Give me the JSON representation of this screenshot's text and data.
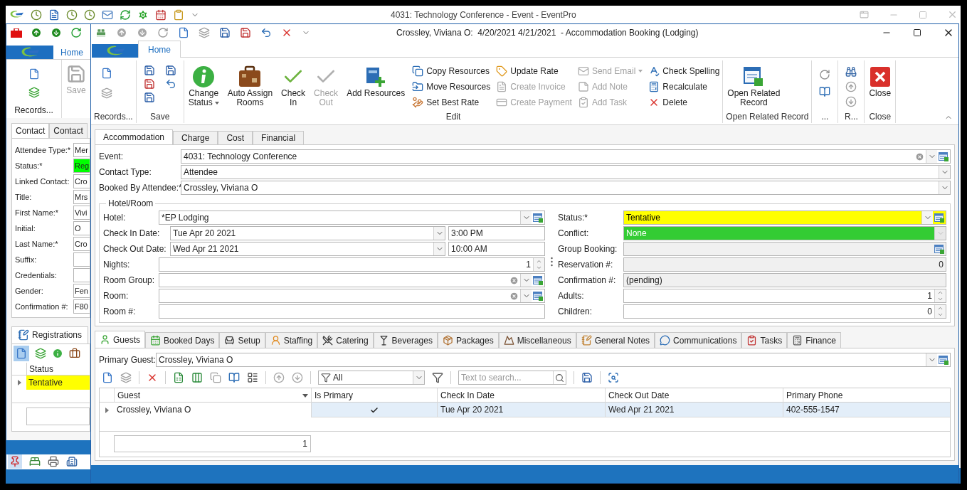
{
  "main_window": {
    "title": "4031: Technology Conference - Event - EventPro"
  },
  "contact_window": {
    "ribbon_tabs": [
      {
        "label": "Home",
        "selected": true
      }
    ],
    "ribbon_groups": [
      {
        "label": "Records..."
      }
    ],
    "save_button": {
      "label": "Save",
      "disabled": true
    },
    "tabs": [
      {
        "label": "Contact",
        "selected": true
      },
      {
        "label": "Contact",
        "selected": false
      }
    ],
    "fields": [
      {
        "label": "Attendee Type:*",
        "value": "Mer"
      },
      {
        "label": "Status:*",
        "value": "Reg",
        "color": "#00ff00"
      },
      {
        "label": "Linked Contact:",
        "value": "Cro"
      },
      {
        "label": "Title:",
        "value": "Mrs"
      },
      {
        "label": "First Name:*",
        "value": "Vivi"
      },
      {
        "label": "Initial:",
        "value": "O"
      },
      {
        "label": "Last Name:*",
        "value": "Cro"
      },
      {
        "label": "Suffix:"
      },
      {
        "label": "Credentials:"
      },
      {
        "label": "Gender:",
        "value": "Fen"
      },
      {
        "label": "Confirmation #:",
        "value": "F80"
      }
    ],
    "lower_tabs": [
      {
        "label": "Registrations",
        "selected": true
      }
    ],
    "grid": {
      "columns": [
        "Status"
      ],
      "rows": [
        {
          "cells": [
            "Tentative"
          ],
          "color": "#ffff00"
        }
      ]
    }
  },
  "booking_window": {
    "title": "Crossley, Viviana O:  4/20/2021 4/21/2021  - Accommodation Booking (Lodging)",
    "ribbon_tabs": [
      {
        "label": "Home",
        "selected": true
      }
    ],
    "ribbon_groups": [
      {
        "label": "Records..."
      },
      {
        "label": "Save"
      },
      {
        "label": "Edit",
        "large": [
          {
            "lines": [
              "Change",
              "Status"
            ],
            "dropdown": true,
            "disabled": false
          },
          {
            "lines": [
              "Auto Assign",
              "Rooms"
            ],
            "disabled": false
          },
          {
            "lines": [
              "Check",
              "In"
            ],
            "disabled": false
          },
          {
            "lines": [
              "Check",
              "Out"
            ],
            "disabled": true
          },
          {
            "lines": [
              "Add Resources"
            ],
            "disabled": false
          }
        ],
        "small_columns": [
          {
            "items": [
              {
                "label": "Copy Resources",
                "disabled": false
              },
              {
                "label": "Move Resources",
                "disabled": false
              },
              {
                "label": "Set Best Rate",
                "disabled": false
              }
            ]
          },
          {
            "items": [
              {
                "label": "Update Rate",
                "disabled": false
              },
              {
                "label": "Create Invoice",
                "disabled": true
              },
              {
                "label": "Create Payment",
                "disabled": true
              }
            ]
          },
          {
            "items": [
              {
                "label": "Send Email",
                "dropdown": true,
                "disabled": true
              },
              {
                "label": "Add Note",
                "disabled": true
              },
              {
                "label": "Add Task",
                "disabled": true
              }
            ]
          },
          {
            "items": [
              {
                "label": "Check Spelling",
                "disabled": false
              },
              {
                "label": "Recalculate",
                "disabled": false
              },
              {
                "label": "Delete",
                "disabled": false
              }
            ]
          }
        ]
      },
      {
        "label": "Open Related Record",
        "large": [
          {
            "lines": [
              "Open Related",
              "Record"
            ],
            "disabled": false
          }
        ]
      },
      {
        "label": "..."
      },
      {
        "label": "R..."
      },
      {
        "label": "Close",
        "large": [
          {
            "lines": [
              "Close"
            ],
            "disabled": false
          }
        ]
      }
    ],
    "form_tabs": [
      {
        "label": "Accommodation",
        "selected": true
      },
      {
        "label": "Charge",
        "selected": false
      },
      {
        "label": "Cost",
        "selected": false
      },
      {
        "label": "Financial",
        "selected": false
      }
    ],
    "top_fields": [
      {
        "label": "Event:",
        "value": "4031: Technology Conference",
        "kind": "clear_lookup"
      },
      {
        "label": "Contact Type:",
        "value": "Attendee",
        "kind": "combo"
      },
      {
        "label": "Booked By Attendee:*",
        "value": "Crossley, Viviana O",
        "kind": "combo"
      }
    ],
    "hotel_room": {
      "title": "Hotel/Room",
      "left_fields": [
        {
          "label": "Hotel:",
          "value": "*EP Lodging",
          "kind": "lookup"
        },
        {
          "label": "Check In Date:",
          "value": "Tue Apr 20 2021",
          "time": "3:00 PM",
          "kind": "date"
        },
        {
          "label": "Check Out Date:",
          "value": "Wed Apr 21 2021",
          "time": "10:00 AM",
          "kind": "date"
        },
        {
          "label": "Nights:",
          "value": "1",
          "kind": "spin"
        },
        {
          "label": "Room Group:",
          "kind": "clear_lookup"
        },
        {
          "label": "Room:",
          "kind": "clear_lookup"
        },
        {
          "label": "Room #:",
          "kind": "text"
        }
      ],
      "right_fields": [
        {
          "label": "Status:*",
          "value": "Tentative",
          "kind": "lookup",
          "color": "#ffff00"
        },
        {
          "label": "Conflict:",
          "value": "None",
          "kind": "disabled_combo",
          "color": "#33cc33"
        },
        {
          "label": "Group Booking:",
          "kind": "readonly_lookup"
        },
        {
          "label": "Reservation #:",
          "value": "0",
          "kind": "readonly_number"
        },
        {
          "label": "Confirmation #:",
          "value": "(pending)",
          "kind": "readonly"
        },
        {
          "label": "Adults:",
          "value": "1",
          "kind": "spin"
        },
        {
          "label": "Children:",
          "value": "0",
          "kind": "spin"
        }
      ]
    },
    "detail_tabs": [
      {
        "label": "Guests",
        "selected": true
      },
      {
        "label": "Booked Days",
        "selected": false
      },
      {
        "label": "Setup",
        "selected": false
      },
      {
        "label": "Staffing",
        "selected": false
      },
      {
        "label": "Catering",
        "selected": false
      },
      {
        "label": "Beverages",
        "selected": false
      },
      {
        "label": "Packages",
        "selected": false
      },
      {
        "label": "Miscellaneous",
        "selected": false
      },
      {
        "label": "General Notes",
        "selected": false
      },
      {
        "label": "Communications",
        "selected": false
      },
      {
        "label": "Tasks",
        "selected": false
      },
      {
        "label": "Finance",
        "selected": false
      }
    ],
    "primary_guest": {
      "label": "Primary Guest:",
      "value": "Crossley, Viviana O"
    },
    "filter": {
      "value": "All"
    },
    "search": {
      "placeholder": "Text to search..."
    },
    "guest_grid": {
      "columns": [
        "Guest",
        "Is Primary",
        "Check In Date",
        "Check Out Date",
        "Primary Phone"
      ],
      "rows": [
        {
          "guest": "Crossley, Viviana O",
          "is_primary": true,
          "check_in": "Tue Apr 20 2021",
          "check_out": "Wed Apr 21 2021",
          "phone": "402-555-1547",
          "selected": true
        }
      ],
      "summary": "1"
    }
  }
}
